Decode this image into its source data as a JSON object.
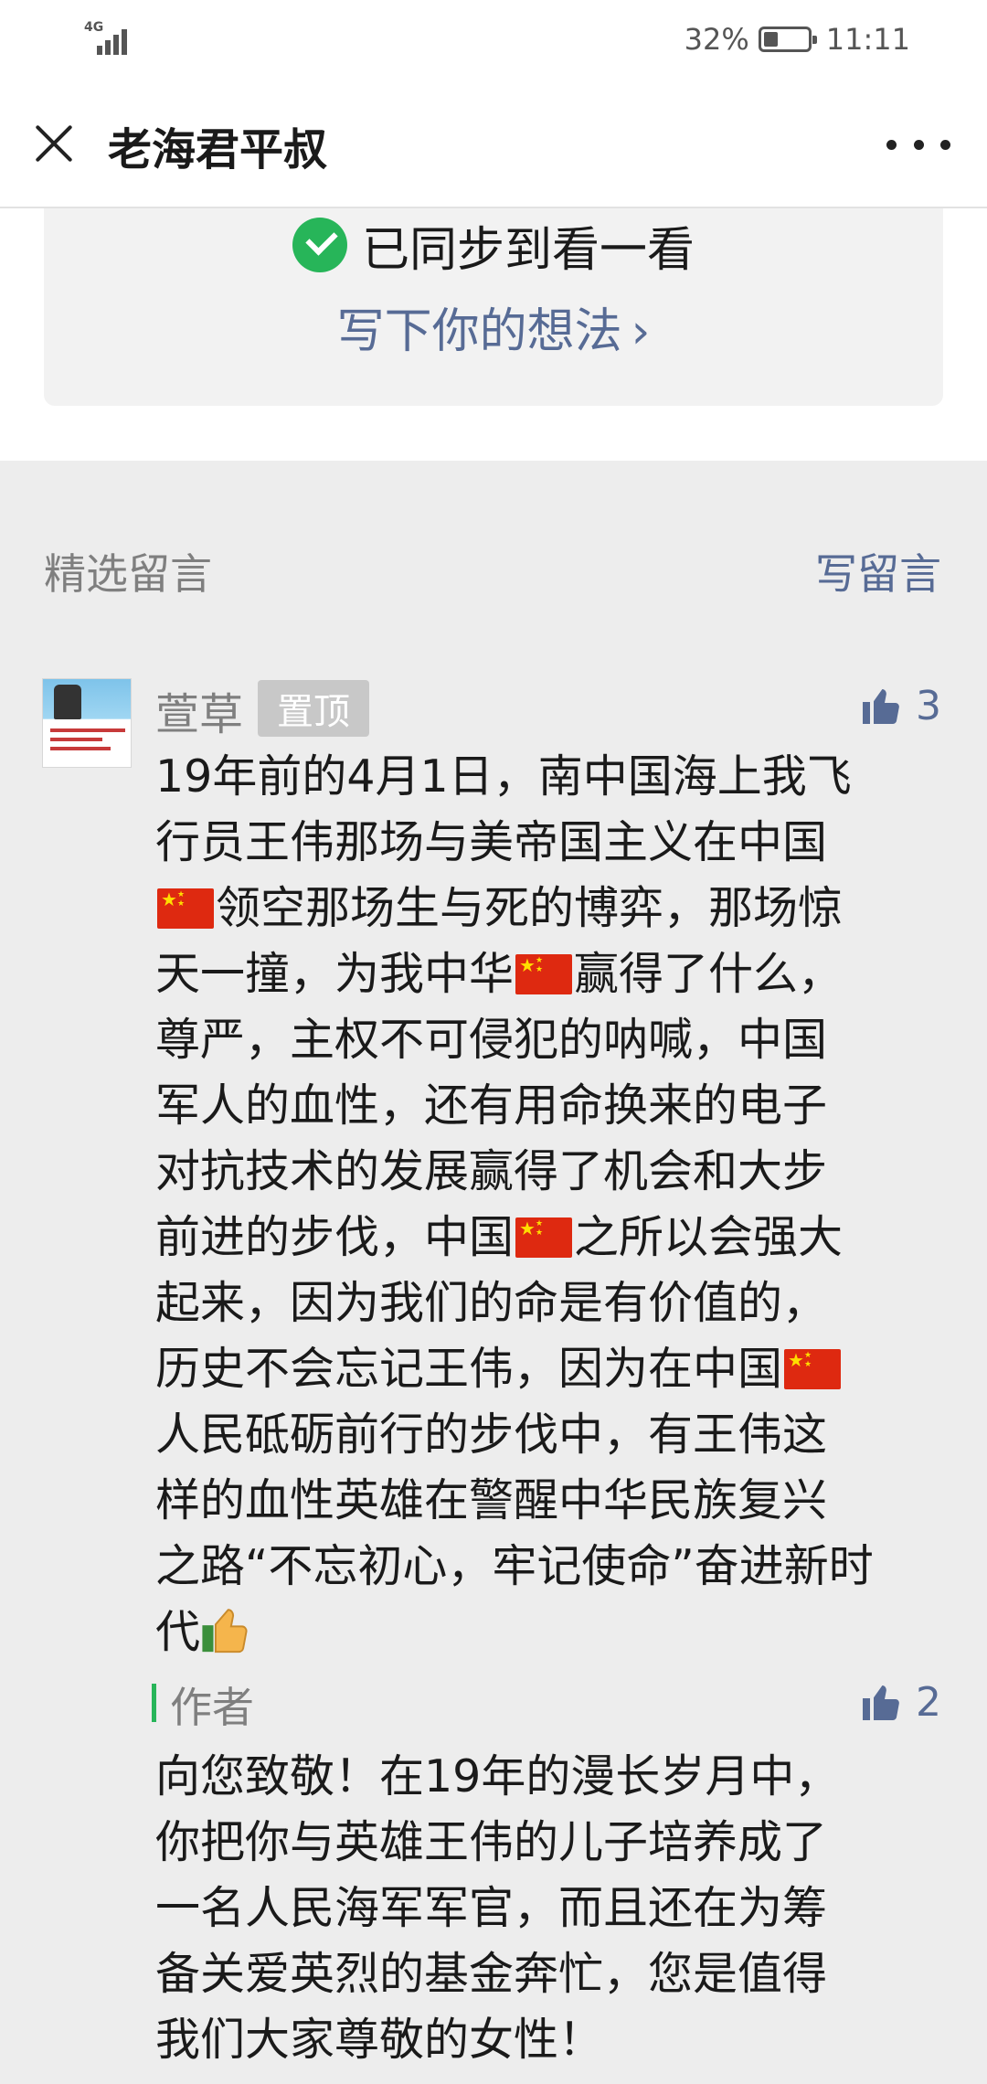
{
  "status_bar": {
    "network": "4G",
    "battery": "32%",
    "battery_level": 0.32,
    "time": "11:11"
  },
  "title_bar": {
    "title": "老海君平叔",
    "close_icon": "close-icon",
    "more_icon": "more-icon"
  },
  "sync": {
    "status": "已同步到看一看",
    "write_thoughts": "写下你的想法",
    "chevron": "›"
  },
  "comments": {
    "section_title": "精选留言",
    "write_label": "写留言",
    "items": [
      {
        "nickname": "萱草",
        "pinned_label": "置顶",
        "likes": "3",
        "lines": [
          "19年前的4月1日，南中国海上我飞",
          "行员王伟那场与美帝国主义在中国",
          "[flag]领空那场生与死的博弈，那场惊",
          "天一撞，为我中华[flag]赢得了什么，",
          "尊严，主权不可侵犯的呐喊，中国",
          "军人的血性，还有用命换来的电子",
          "对抗技术的发展赢得了机会和大步",
          "前进的步伐，中国[flag]之所以会强大",
          "起来，因为我们的命是有价值的，",
          "历史不会忘记王伟，因为在中国[flag]",
          "人民砥砺前行的步伐中，有王伟这",
          "样的血性英雄在警醒中华民族复兴",
          "之路“不忘初心，牢记使命”奋进新时",
          "代[thumbs]"
        ],
        "reply": {
          "label": "作者",
          "likes": "2",
          "lines": [
            "向您致敬！在19年的漫长岁月中，",
            "你把你与英雄王伟的儿子培养成了",
            "一名人民海军军官，而且还在为筹",
            "备关爱英烈的基金奔忙，您是值得",
            "我们大家尊敬的女性！"
          ]
        }
      }
    ]
  }
}
